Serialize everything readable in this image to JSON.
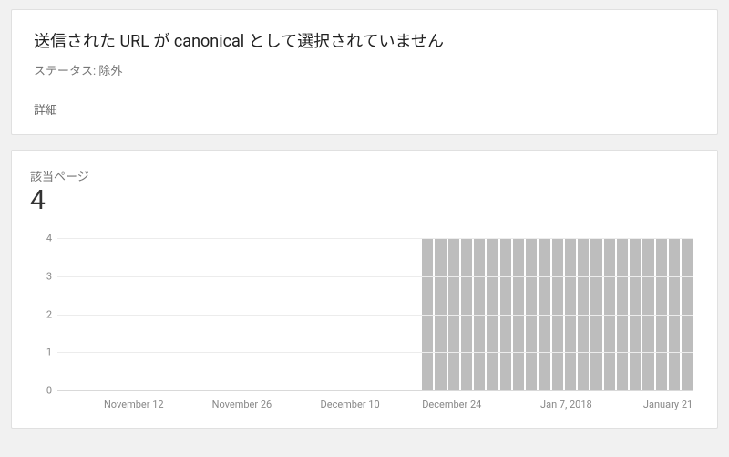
{
  "header": {
    "title": "送信された URL が canonical として選択されていません",
    "status": "ステータス: 除外",
    "details": "詳細"
  },
  "metric": {
    "label": "該当ページ",
    "value": "4"
  },
  "chart_data": {
    "type": "bar",
    "title": "",
    "xlabel": "",
    "ylabel": "",
    "ylim": [
      0,
      4
    ],
    "y_ticks": [
      0,
      1,
      2,
      3,
      4
    ],
    "x_tick_labels": [
      "November 12",
      "November 26",
      "December 10",
      "December 24",
      "Jan 7, 2018",
      "January 21"
    ],
    "categories_count": 49,
    "values": [
      0,
      0,
      0,
      0,
      0,
      0,
      0,
      0,
      0,
      0,
      0,
      0,
      0,
      0,
      0,
      0,
      0,
      0,
      0,
      0,
      0,
      0,
      0,
      0,
      0,
      0,
      0,
      0,
      4,
      4,
      4,
      4,
      4,
      4,
      4,
      4,
      4,
      4,
      4,
      4,
      4,
      4,
      4,
      4,
      4,
      4,
      4,
      4,
      4
    ]
  }
}
